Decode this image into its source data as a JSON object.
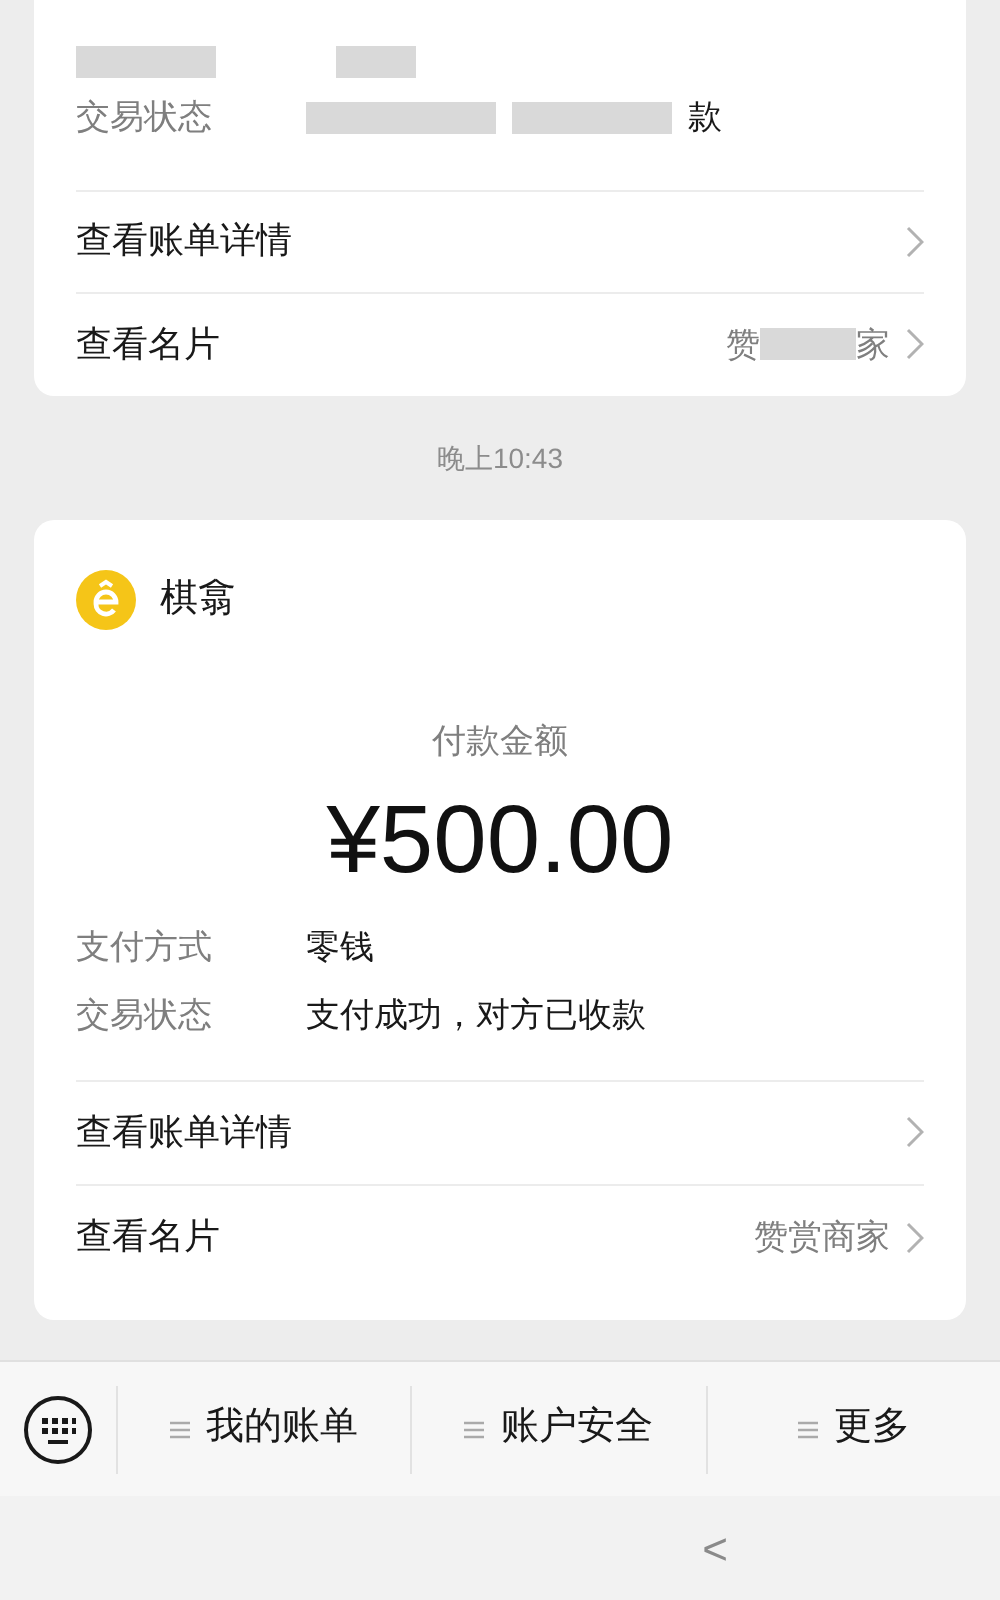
{
  "previous_card": {
    "status_label": "交易状态",
    "status_value_fragment": "款",
    "links": [
      {
        "label": "查看账单详情"
      },
      {
        "label": "查看名片",
        "value_fragments": [
          "赞",
          "家"
        ]
      }
    ]
  },
  "timestamp": "晚上10:43",
  "payment_card": {
    "merchant": "棋翕",
    "amount_label": "付款金额",
    "amount": "¥500.00",
    "details": [
      {
        "label": "支付方式",
        "value": "零钱"
      },
      {
        "label": "交易状态",
        "value": "支付成功，对方已收款"
      }
    ],
    "links": [
      {
        "label": "查看账单详情"
      },
      {
        "label": "查看名片",
        "value": "赞赏商家"
      }
    ]
  },
  "menu": [
    {
      "label": "我的账单"
    },
    {
      "label": "账户安全"
    },
    {
      "label": "更多"
    }
  ],
  "nav": {
    "back": "<"
  }
}
